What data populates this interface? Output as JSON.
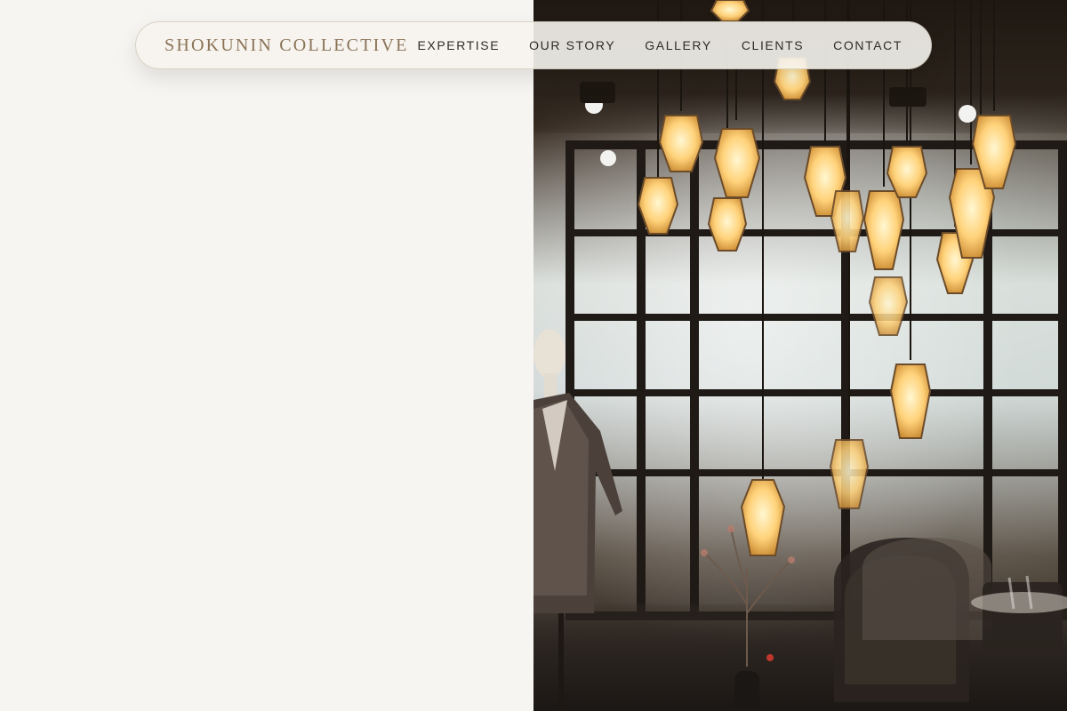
{
  "nav": {
    "brand": "SHOKUNIN COLLECTIVE",
    "links": [
      "EXPERTISE",
      "OUR STORY",
      "GALLERY",
      "CLIENTS",
      "CONTACT"
    ]
  },
  "colors": {
    "left_panel_background": "#f7f5f1",
    "brand_text": "#8a7356",
    "nav_text": "#2f2b26",
    "navbar_background": "#f6f4ee"
  },
  "hero_image": {
    "icon": "interior-photo-icon"
  }
}
